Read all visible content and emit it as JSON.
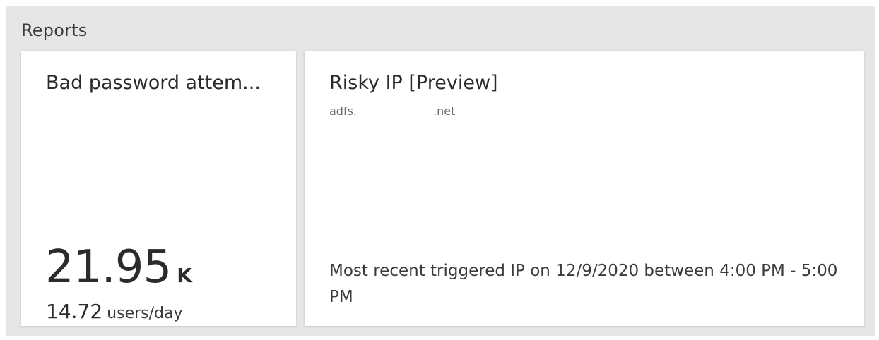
{
  "reports": {
    "title": "Reports",
    "tiles": [
      {
        "title": "Bad password attem...",
        "metric_value": "21.95",
        "metric_unit": "K",
        "sub_value": "14.72",
        "sub_unit": "users/day"
      },
      {
        "title": "Risky IP [Preview]",
        "subtitle_prefix": "adfs.",
        "subtitle_suffix": ".net",
        "description": "Most recent triggered IP on 12/9/2020 between 4:00 PM - 5:00 PM"
      }
    ]
  },
  "colors": {
    "panel_bg": "#e6e6e6",
    "tile_bg": "#ffffff",
    "text_primary": "#2b2b2b",
    "text_secondary": "#6b6b6b"
  }
}
